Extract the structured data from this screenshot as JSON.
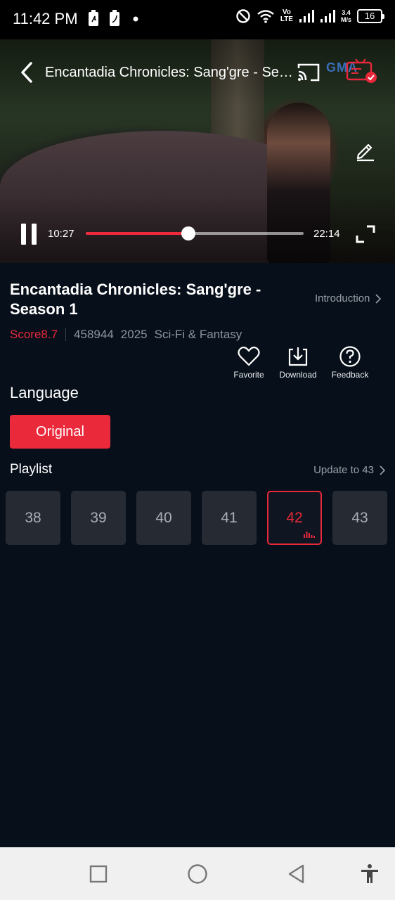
{
  "status_bar": {
    "time": "11:42 PM",
    "net_speed_value": "3.4",
    "net_speed_unit": "M/s",
    "volte_top": "Vo",
    "volte_bottom": "LTE",
    "battery": "16",
    "icons": [
      "battery-saver-icon",
      "battery-saver-icon",
      "dot-icon",
      "do-not-disturb-icon",
      "wifi-icon",
      "signal-icon",
      "signal-icon"
    ]
  },
  "player": {
    "title": "Encantadia Chronicles: Sang'gre - Season 1",
    "channel_logo": "GMA",
    "current_time": "10:27",
    "duration": "22:14",
    "progress": 0.47,
    "state": "playing"
  },
  "show": {
    "title": "Encantadia Chronicles: Sang'gre - Season 1",
    "intro_link": "Introduction",
    "score": "Score8.7",
    "views": "458944",
    "year": "2025",
    "genre": "Sci-Fi & Fantasy"
  },
  "actions": [
    {
      "label": "Favorite",
      "icon": "heart-icon"
    },
    {
      "label": "Download",
      "icon": "download-icon"
    },
    {
      "label": "Feedback",
      "icon": "question-icon"
    }
  ],
  "language": {
    "heading": "Language",
    "selected": "Original"
  },
  "playlist": {
    "heading": "Playlist",
    "update_text": "Update to 43",
    "episodes": [
      "38",
      "39",
      "40",
      "41",
      "42",
      "43"
    ],
    "active_episode": "42"
  },
  "colors": {
    "accent": "#e8283a",
    "background": "#070f1a",
    "tile": "#262b33"
  },
  "nav_bar": {
    "buttons": [
      "recents-square-icon",
      "home-circle-icon",
      "back-triangle-icon",
      "accessibility-icon"
    ]
  }
}
